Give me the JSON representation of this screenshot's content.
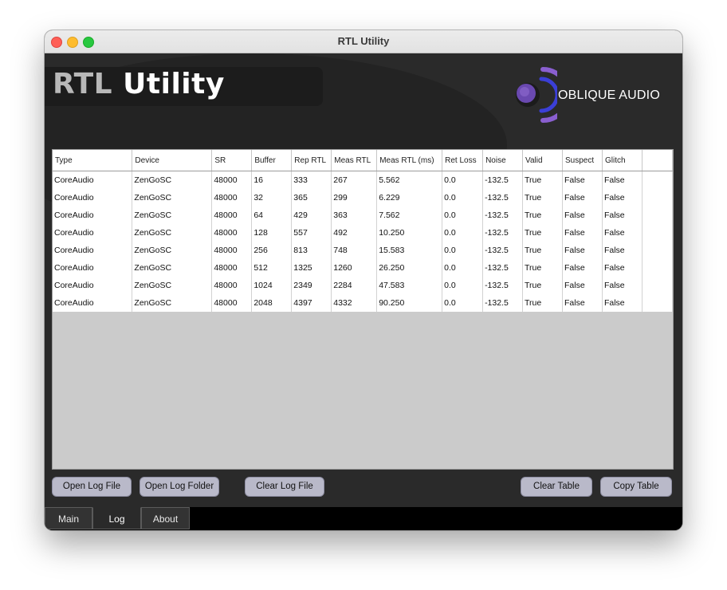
{
  "window": {
    "title": "RTL Utility"
  },
  "header": {
    "title_part1": "RTL",
    "title_part2": "Utility",
    "logo_text": "OBLIQUE AUDIO"
  },
  "table": {
    "columns": [
      "Type",
      "Device",
      "SR",
      "Buffer",
      "Rep RTL",
      "Meas RTL",
      "Meas RTL (ms)",
      "Ret Loss",
      "Noise",
      "Valid",
      "Suspect",
      "Glitch"
    ],
    "rows": [
      [
        "CoreAudio",
        "ZenGoSC",
        "48000",
        "16",
        "333",
        "267",
        "5.562",
        "0.0",
        "-132.5",
        "True",
        "False",
        "False"
      ],
      [
        "CoreAudio",
        "ZenGoSC",
        "48000",
        "32",
        "365",
        "299",
        "6.229",
        "0.0",
        "-132.5",
        "True",
        "False",
        "False"
      ],
      [
        "CoreAudio",
        "ZenGoSC",
        "48000",
        "64",
        "429",
        "363",
        "7.562",
        "0.0",
        "-132.5",
        "True",
        "False",
        "False"
      ],
      [
        "CoreAudio",
        "ZenGoSC",
        "48000",
        "128",
        "557",
        "492",
        "10.250",
        "0.0",
        "-132.5",
        "True",
        "False",
        "False"
      ],
      [
        "CoreAudio",
        "ZenGoSC",
        "48000",
        "256",
        "813",
        "748",
        "15.583",
        "0.0",
        "-132.5",
        "True",
        "False",
        "False"
      ],
      [
        "CoreAudio",
        "ZenGoSC",
        "48000",
        "512",
        "1325",
        "1260",
        "26.250",
        "0.0",
        "-132.5",
        "True",
        "False",
        "False"
      ],
      [
        "CoreAudio",
        "ZenGoSC",
        "48000",
        "1024",
        "2349",
        "2284",
        "47.583",
        "0.0",
        "-132.5",
        "True",
        "False",
        "False"
      ],
      [
        "CoreAudio",
        "ZenGoSC",
        "48000",
        "2048",
        "4397",
        "4332",
        "90.250",
        "0.0",
        "-132.5",
        "True",
        "False",
        "False"
      ]
    ]
  },
  "buttons": {
    "open_log_file": "Open Log File",
    "open_log_folder": "Open Log Folder",
    "clear_log_file": "Clear Log File",
    "clear_table": "Clear Table",
    "copy_table": "Copy Table"
  },
  "tabs": [
    {
      "label": "Main",
      "active": false
    },
    {
      "label": "Log",
      "active": true
    },
    {
      "label": "About",
      "active": false
    }
  ],
  "colors": {
    "logo_purple": "#8a5fd0",
    "logo_blue": "#3b3fd6",
    "button_bg": "#b9b9c9"
  }
}
